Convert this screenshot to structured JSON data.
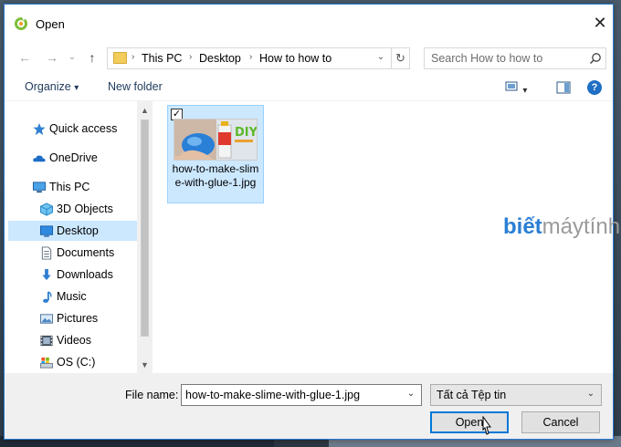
{
  "window": {
    "title": "Open",
    "close_glyph": "✕",
    "border_color": "#2b7bd0"
  },
  "nav": {
    "back_icon": "arrow-left-icon",
    "forward_icon": "arrow-right-icon",
    "up_icon": "arrow-up-icon",
    "back_glyph": "←",
    "forward_glyph": "→",
    "recent_glyph": "⌄",
    "up_glyph": "↑"
  },
  "address": {
    "breadcrumbs": [
      "This PC",
      "Desktop",
      "How to how to"
    ],
    "separator": "›",
    "dropdown_glyph": "⌄",
    "refresh_glyph": "↻"
  },
  "search": {
    "placeholder": "Search How to how to"
  },
  "toolbar": {
    "organize_label": "Organize",
    "organize_arrow": "▾",
    "new_folder_label": "New folder",
    "view_arrow": "▾",
    "help_glyph": "?"
  },
  "sidebar": {
    "items": [
      {
        "label": "Quick access",
        "icon": "star-icon"
      },
      {
        "label": "OneDrive",
        "icon": "cloud-icon"
      },
      {
        "label": "This PC",
        "icon": "computer-icon"
      },
      {
        "label": "3D Objects",
        "icon": "cube-icon"
      },
      {
        "label": "Desktop",
        "icon": "desktop-icon",
        "selected": true
      },
      {
        "label": "Documents",
        "icon": "document-icon"
      },
      {
        "label": "Downloads",
        "icon": "download-icon"
      },
      {
        "label": "Music",
        "icon": "music-icon"
      },
      {
        "label": "Pictures",
        "icon": "pictures-icon"
      },
      {
        "label": "Videos",
        "icon": "videos-icon"
      },
      {
        "label": "OS (C:)",
        "icon": "drive-icon"
      }
    ],
    "scroll_up_glyph": "▲",
    "scroll_down_glyph": "▼"
  },
  "files": [
    {
      "name": "how-to-make-slime-with-glue-1.jpg",
      "checked": true,
      "check_glyph": "✓",
      "thumbnail_text": "DIY"
    }
  ],
  "watermark": {
    "part1": "biết",
    "part2": "máytính",
    "color1": "#2a7fd4",
    "color2": "#9a9a9a"
  },
  "footer": {
    "file_name_label": "File name:",
    "file_name_value": "how-to-make-slime-with-glue-1.jpg",
    "file_type_value": "Tất cả Tệp tin",
    "dropdown_glyph": "⌄",
    "open_label": "Open",
    "cancel_label": "Cancel"
  },
  "colors": {
    "accent": "#0078d7",
    "selection": "#cce8ff",
    "footer_bg": "#f0f0f0"
  }
}
